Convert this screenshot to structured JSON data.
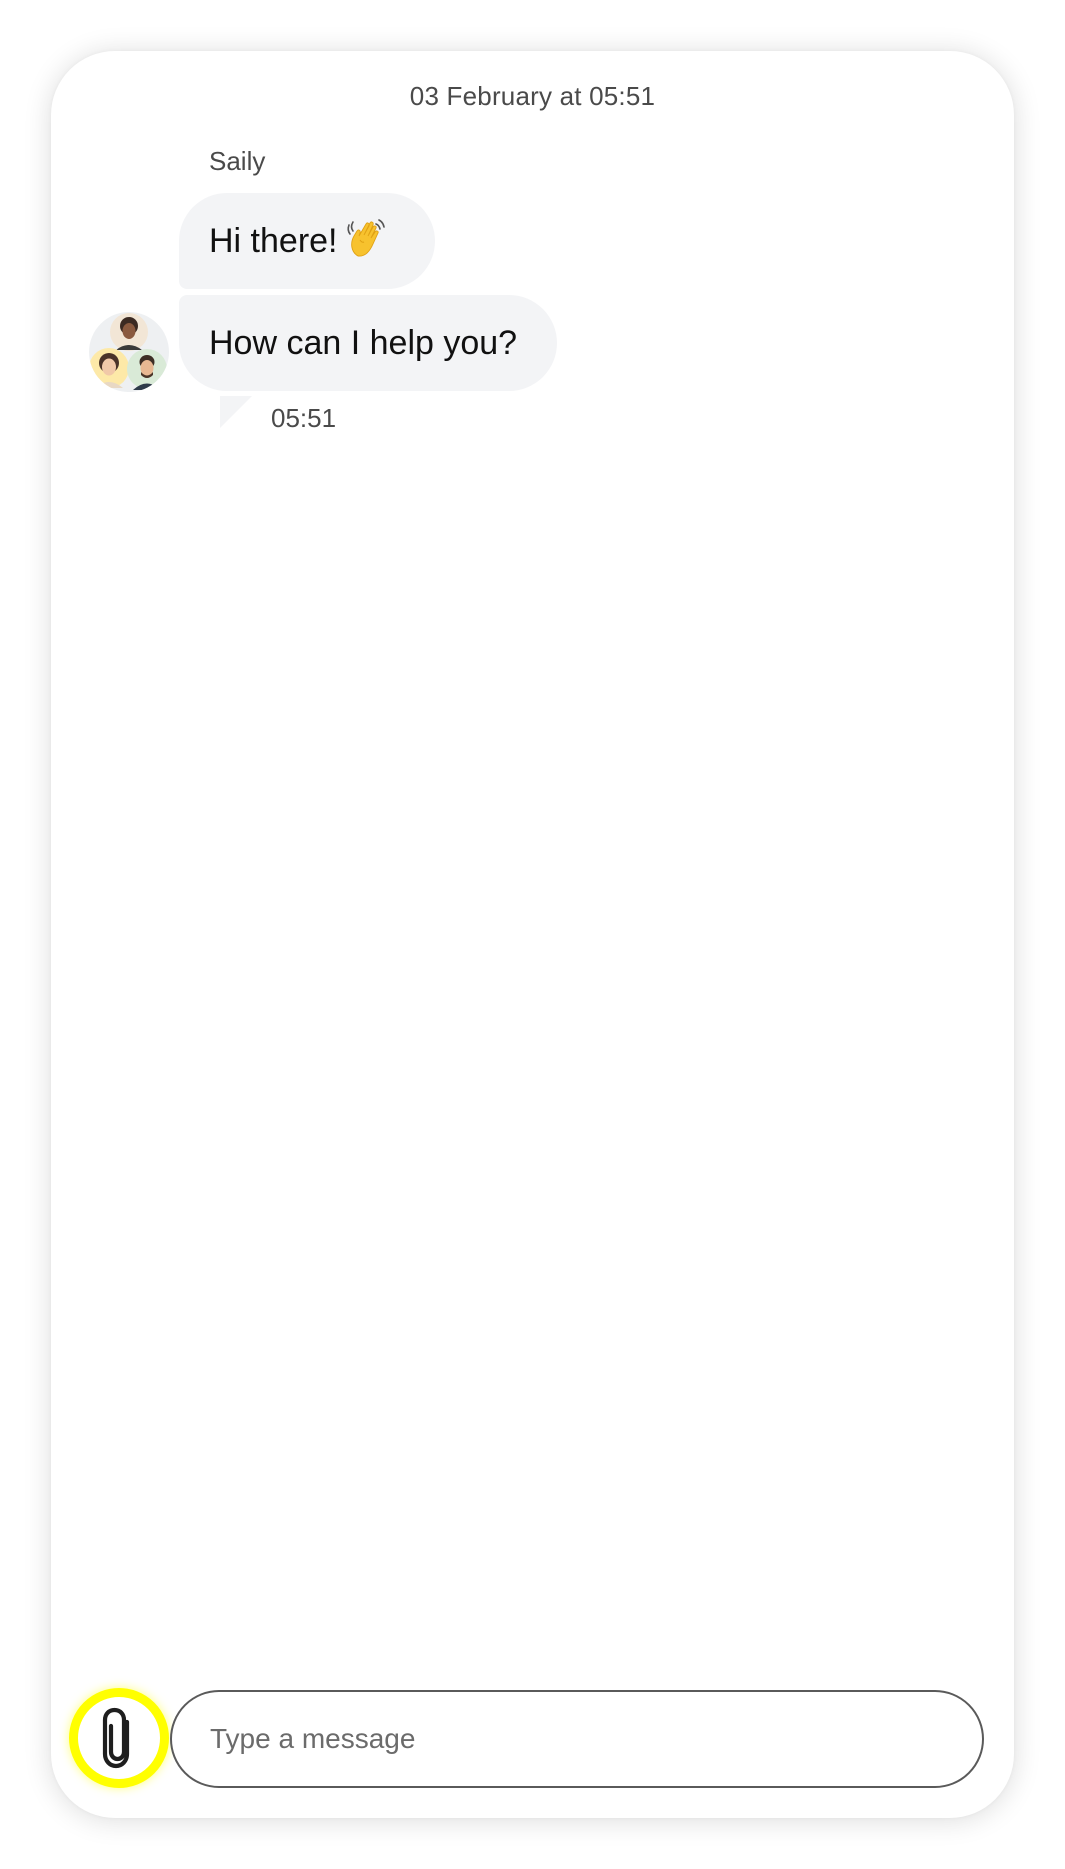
{
  "chat": {
    "date_header": "03 February at 05:51",
    "sender_name": "Saily",
    "messages": [
      {
        "text": "Hi there!",
        "emoji": "waving-hand-emoji"
      },
      {
        "text": "How can I help you?"
      }
    ],
    "timestamp": "05:51",
    "avatar": "agent-team-avatars"
  },
  "composer": {
    "attach_icon": "paperclip-icon",
    "placeholder": "Type a message",
    "value": ""
  },
  "colors": {
    "bubble_bg": "#f3f4f6",
    "highlight_ring": "#ffff00",
    "text_primary": "#111111",
    "text_secondary": "#4a4a4a",
    "input_border": "#5a5a5a"
  }
}
